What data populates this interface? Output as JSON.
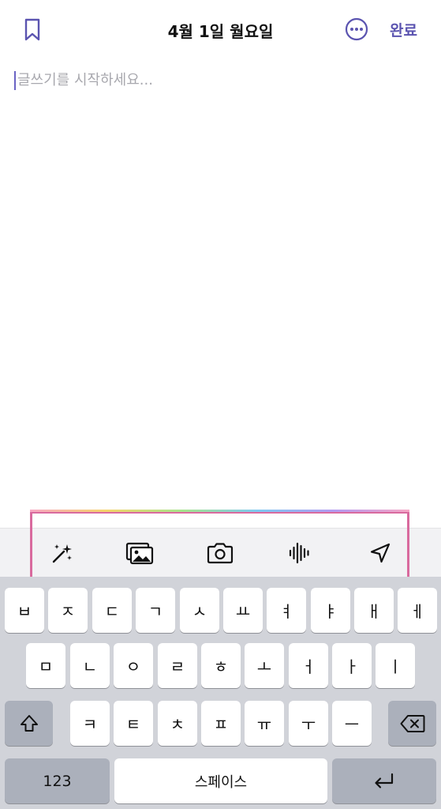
{
  "header": {
    "title": "4월 1일 월요일",
    "done_label": "완료",
    "bookmark_icon": "bookmark-icon",
    "more_icon": "more-options-icon"
  },
  "editor": {
    "placeholder": "글쓰기를 시작하세요..."
  },
  "toolbar": {
    "icons": [
      "magic-wand-icon",
      "photo-gallery-icon",
      "camera-icon",
      "audio-waveform-icon",
      "location-arrow-icon"
    ]
  },
  "keyboard": {
    "row1": [
      "ㅂ",
      "ㅈ",
      "ㄷ",
      "ㄱ",
      "ㅅ",
      "ㅛ",
      "ㅕ",
      "ㅑ",
      "ㅐ",
      "ㅔ"
    ],
    "row2": [
      "ㅁ",
      "ㄴ",
      "ㅇ",
      "ㄹ",
      "ㅎ",
      "ㅗ",
      "ㅓ",
      "ㅏ",
      "ㅣ"
    ],
    "row3": [
      "ㅋ",
      "ㅌ",
      "ㅊ",
      "ㅍ",
      "ㅠ",
      "ㅜ",
      "ㅡ"
    ],
    "numbers_label": "123",
    "space_label": "스페이스"
  },
  "colors": {
    "accent": "#5b54b0",
    "frame": "#d96a9e",
    "keyboard_bg": "#d1d3d9"
  }
}
